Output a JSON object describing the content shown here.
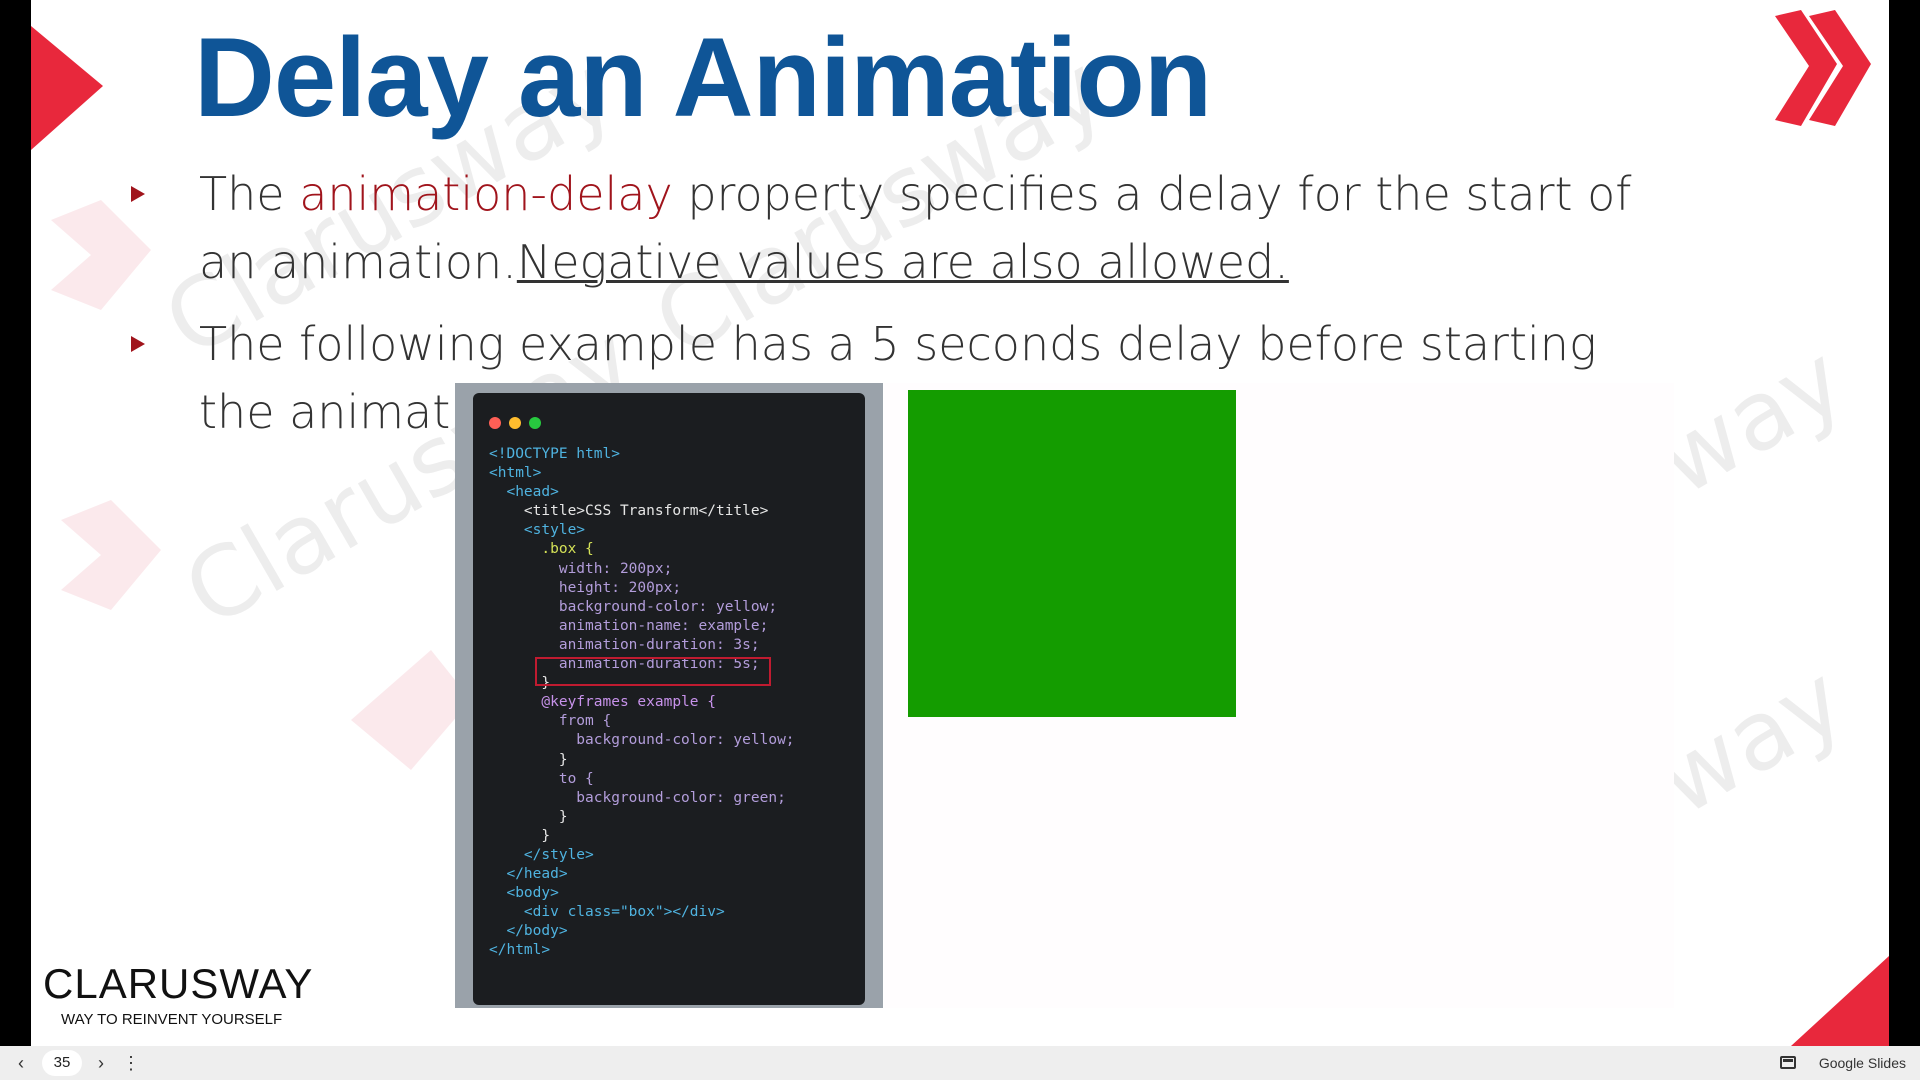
{
  "slide": {
    "title": "Delay an Animation",
    "bullet1": {
      "pre": "The ",
      "highlight": "animation-delay",
      "mid": " property specifies a delay for the start of an animation.",
      "underlined": "Negative values are also allowed."
    },
    "bullet2": "The following example has a 5 seconds delay before starting the animation:",
    "watermark": "Clarusway",
    "demo_box_color": "#149c00",
    "accent_color": "#e8283c",
    "title_color": "#0f5597"
  },
  "code": {
    "lines": [
      "<!DOCTYPE html>",
      "<html>",
      "  <head>",
      "    <title>CSS Transform</title>",
      "    <style>",
      "      .box {",
      "        width: 200px;",
      "        height: 200px;",
      "        background-color: yellow;",
      "        animation-name: example;",
      "        animation-duration: 3s;",
      "        animation-duration: 5s;",
      "      }",
      "      @keyframes example {",
      "        from {",
      "          background-color: yellow;",
      "        }",
      "        to {",
      "          background-color: green;",
      "        }",
      "      }",
      "    </style>",
      "  </head>",
      "  <body>",
      "    <div class=\"box\"></div>",
      "  </body>",
      "</html>"
    ]
  },
  "logo": {
    "name": "CLARUSWAY",
    "tagline": "WAY TO REINVENT YOURSELF"
  },
  "bottombar": {
    "prev_icon": "chevron-left-icon",
    "page_number": "35",
    "next_icon": "chevron-right-icon",
    "more_icon": "more-vert-icon",
    "app_label": "Google Slides"
  }
}
